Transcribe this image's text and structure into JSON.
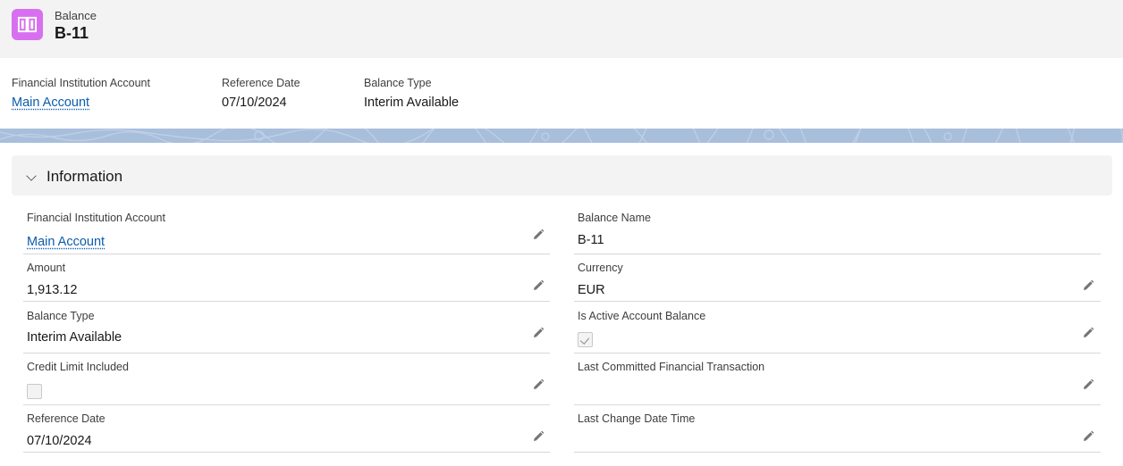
{
  "header": {
    "object_label": "Balance",
    "record_title": "B-11",
    "icon": "book-icon",
    "icon_color": "#d86ff0"
  },
  "highlights": [
    {
      "label": "Financial Institution Account",
      "value": "Main Account",
      "is_link": true
    },
    {
      "label": "Reference Date",
      "value": "07/10/2024",
      "is_link": false
    },
    {
      "label": "Balance Type",
      "value": "Interim Available",
      "is_link": false
    }
  ],
  "section": {
    "title": "Information",
    "icon": "chevron-down-icon"
  },
  "fields": {
    "left": [
      {
        "label": "Financial Institution Account",
        "value": "Main Account",
        "type": "link",
        "editable": true
      },
      {
        "label": "Amount",
        "value": "1,913.12",
        "type": "text",
        "editable": true
      },
      {
        "label": "Balance Type",
        "value": "Interim Available",
        "type": "text",
        "editable": true
      },
      {
        "label": "Credit Limit Included",
        "value": "",
        "type": "checkbox",
        "checked": false,
        "editable": true
      },
      {
        "label": "Reference Date",
        "value": "07/10/2024",
        "type": "text",
        "editable": true
      }
    ],
    "right": [
      {
        "label": "Balance Name",
        "value": "B-11",
        "type": "text",
        "editable": false
      },
      {
        "label": "Currency",
        "value": "EUR",
        "type": "text",
        "editable": true
      },
      {
        "label": "Is Active Account Balance",
        "value": "",
        "type": "checkbox",
        "checked": true,
        "editable": true
      },
      {
        "label": "Last Committed Financial Transaction",
        "value": "",
        "type": "text",
        "editable": true
      },
      {
        "label": "Last Change Date Time",
        "value": "",
        "type": "text",
        "editable": true
      }
    ]
  },
  "colors": {
    "link": "#0b5cab",
    "banner": "#a8bfdc",
    "header_bg": "#f3f3f3"
  }
}
